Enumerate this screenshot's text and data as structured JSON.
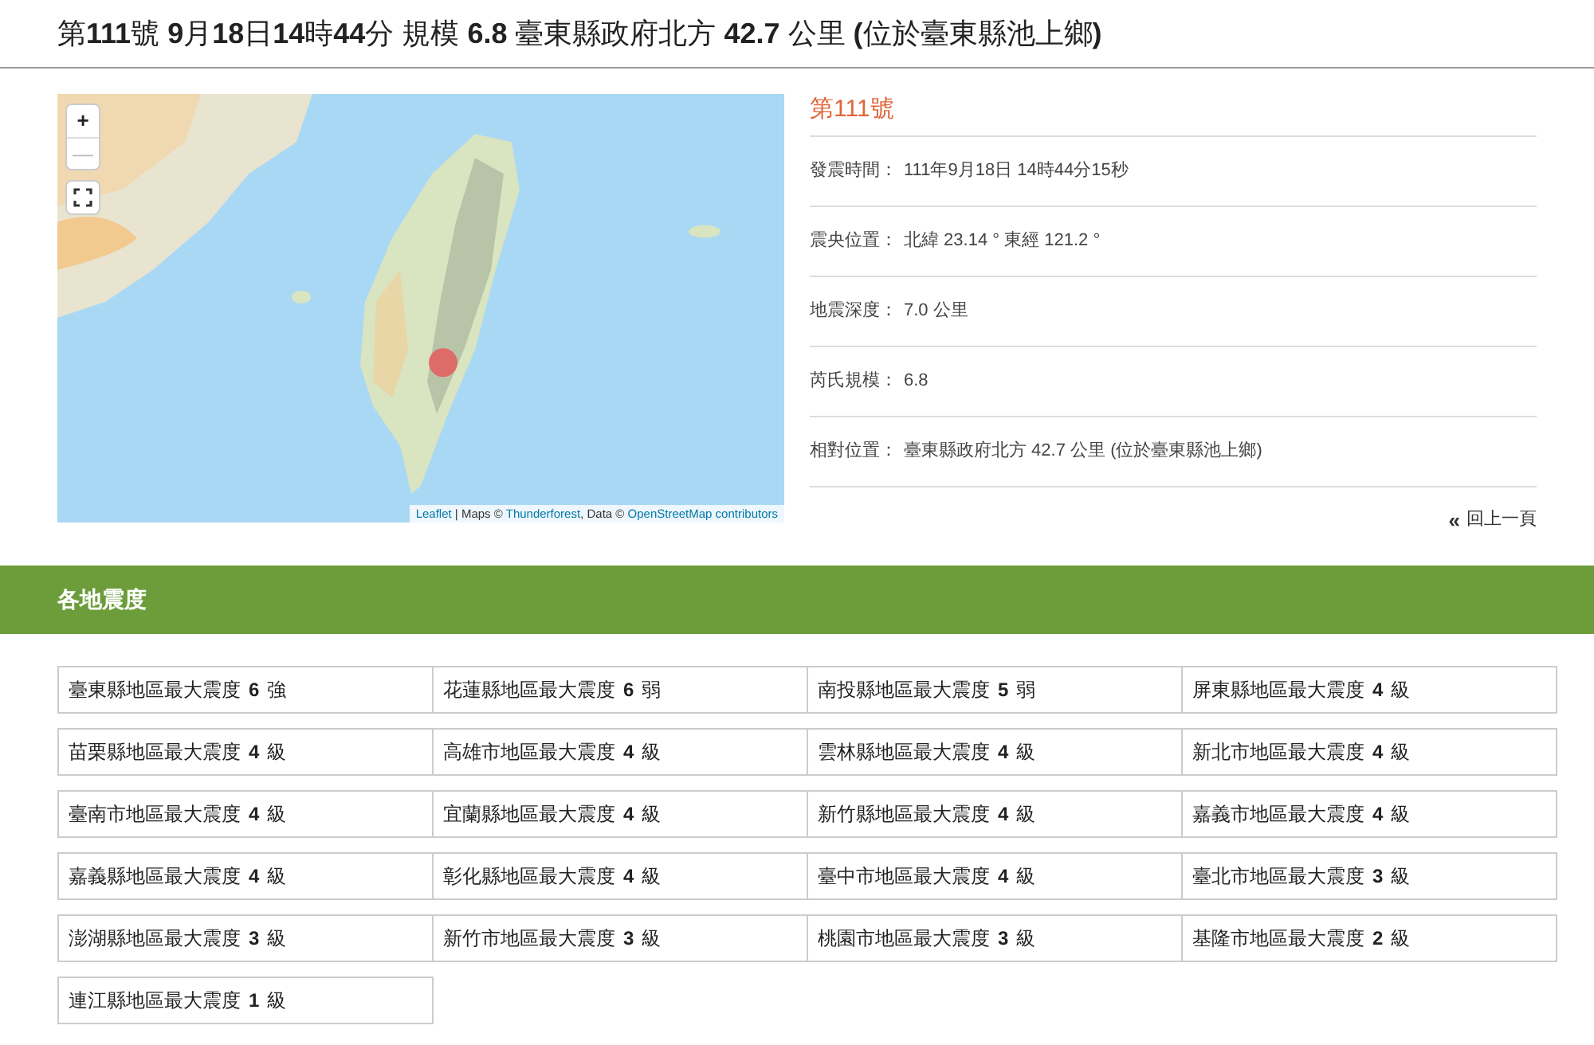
{
  "title": "第**111**號 **9**月**18**日**14**時**44**分 規模 **6.8** 臺東縣政府北方 **42.7** 公里 **(**位於臺東縣池上鄉**)**",
  "map": {
    "kind": "picture",
    "controls": [
      {
        "kind": "zoom-in",
        "label": "+"
      },
      {
        "kind": "zoom-out",
        "label": "—"
      },
      {
        "kind": "fullscreen"
      }
    ],
    "attribution": [
      {
        "text": "Leaflet",
        "link": true
      },
      {
        "text": " | Maps © ",
        "link": false
      },
      {
        "text": "Thunderforest",
        "link": true
      },
      {
        "text": ", Data © ",
        "link": false
      },
      {
        "text": "OpenStreetMap contributors",
        "link": true
      }
    ]
  },
  "details": {
    "heading": "第111號",
    "rows": [
      {
        "label": "發震時間：",
        "value": "111年9月18日 14時44分15秒"
      },
      {
        "label": "震央位置：",
        "value": "北緯 23.14 ° 東經 121.2 °"
      },
      {
        "label": "地震深度：",
        "value": "7.0 公里"
      },
      {
        "label": "芮氏規模：",
        "value": "6.8"
      },
      {
        "label": "相對位置：",
        "value": "臺東縣政府北方 42.7 公里 (位於臺東縣池上鄉)"
      }
    ],
    "back_link": {
      "icon": "«",
      "label": "回上一頁"
    }
  },
  "section": {
    "title": "各地震度",
    "regions": [
      {
        "label": "臺東縣地區最大震度",
        "level": "6",
        "unit": "強"
      },
      {
        "label": "花蓮縣地區最大震度",
        "level": "6",
        "unit": "弱"
      },
      {
        "label": "南投縣地區最大震度",
        "level": "5",
        "unit": "弱"
      },
      {
        "label": "屏東縣地區最大震度",
        "level": "4",
        "unit": "級"
      },
      {
        "label": "苗栗縣地區最大震度",
        "level": "4",
        "unit": "級"
      },
      {
        "label": "高雄市地區最大震度",
        "level": "4",
        "unit": "級"
      },
      {
        "label": "雲林縣地區最大震度",
        "level": "4",
        "unit": "級"
      },
      {
        "label": "新北市地區最大震度",
        "level": "4",
        "unit": "級"
      },
      {
        "label": "臺南市地區最大震度",
        "level": "4",
        "unit": "級"
      },
      {
        "label": "宜蘭縣地區最大震度",
        "level": "4",
        "unit": "級"
      },
      {
        "label": "新竹縣地區最大震度",
        "level": "4",
        "unit": "級"
      },
      {
        "label": "嘉義市地區最大震度",
        "level": "4",
        "unit": "級"
      },
      {
        "label": "嘉義縣地區最大震度",
        "level": "4",
        "unit": "級"
      },
      {
        "label": "彰化縣地區最大震度",
        "level": "4",
        "unit": "級"
      },
      {
        "label": "臺中市地區最大震度",
        "level": "4",
        "unit": "級"
      },
      {
        "label": "臺北市地區最大震度",
        "level": "3",
        "unit": "級"
      },
      {
        "label": "澎湖縣地區最大震度",
        "level": "3",
        "unit": "級"
      },
      {
        "label": "新竹市地區最大震度",
        "level": "3",
        "unit": "級"
      },
      {
        "label": "桃園市地區最大震度",
        "level": "3",
        "unit": "級"
      },
      {
        "label": "基隆市地區最大震度",
        "level": "2",
        "unit": "級"
      },
      {
        "label": "連江縣地區最大震度",
        "level": "1",
        "unit": "級"
      }
    ]
  }
}
